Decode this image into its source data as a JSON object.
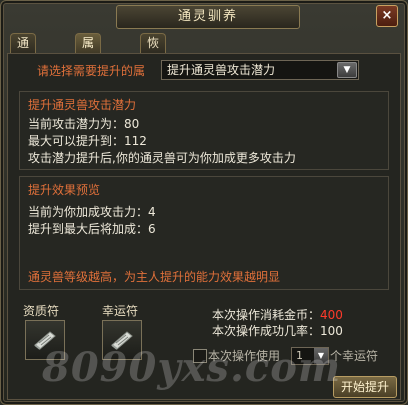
{
  "window": {
    "title": "通灵驯养",
    "close": "×"
  },
  "tabs": [
    {
      "label": "通灵进阶"
    },
    {
      "label": "属性提升"
    },
    {
      "label": "恢复活力"
    }
  ],
  "select": {
    "prompt": "请选择需要提升的属",
    "value": "提升通灵兽攻击潜力",
    "arrow_icon": "▼"
  },
  "info": {
    "title": "提升通灵兽攻击潜力",
    "lines": [
      "当前攻击潜力为：80",
      "最大可以提升到：112",
      "攻击潜力提升后,你的通灵兽可为你加成更多攻击力"
    ]
  },
  "preview": {
    "title": "提升效果预览",
    "lines": [
      "当前为你加成攻击力：4",
      "提升到最大后将加成：6"
    ],
    "note": "通灵兽等级越高，为主人提升的能力效果越明显"
  },
  "slots": [
    {
      "label": "资质符",
      "icon": "scroll-icon"
    },
    {
      "label": "幸运符",
      "icon": "scroll-icon"
    }
  ],
  "cost": {
    "gold_label": "本次操作消耗金币：",
    "gold_value": "400",
    "rate_label": "本次操作成功几率：100"
  },
  "use_option": {
    "label": "本次操作使用",
    "quantity": "1",
    "unit": "个幸运符"
  },
  "start_button": "开始提升",
  "watermark": "8090yxs.com",
  "colors": {
    "accent": "#e0703a",
    "cost": "#ff3a2a"
  }
}
